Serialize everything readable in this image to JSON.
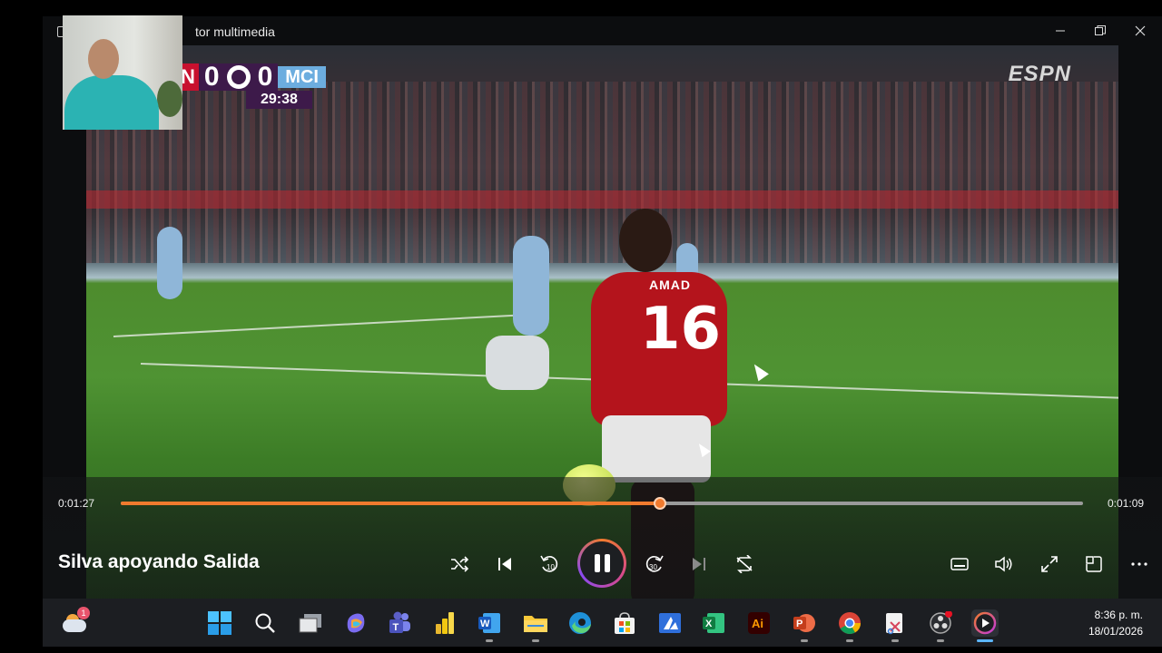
{
  "window": {
    "title": "tor multimedia",
    "minimize_icon": "minimize-icon",
    "restore_icon": "restore-icon",
    "close_icon": "close-icon"
  },
  "video": {
    "scoreboard": {
      "home_team": "N",
      "home_score": "0",
      "away_score": "0",
      "away_team": "MCI",
      "match_clock": "29:38"
    },
    "broadcaster": "ESPN",
    "jersey_name": "AMAD",
    "jersey_number": "16"
  },
  "player": {
    "elapsed": "0:01:27",
    "remaining": "0:01:09",
    "progress": 0.56,
    "title": "Silva apoyando Salida",
    "accent_color": "#f07a2e",
    "buttons": {
      "shuffle": "shuffle-icon",
      "previous": "previous-icon",
      "rewind": "10",
      "play_pause": "pause-icon",
      "forward": "30",
      "next": "next-icon",
      "repeat": "repeat-icon",
      "subtitles": "subtitles-icon",
      "volume": "volume-icon",
      "fullscreen": "fullscreen-icon",
      "miniplayer": "miniplayer-icon",
      "more": "more-icon"
    }
  },
  "taskbar": {
    "widget_badge": "1",
    "apps": [
      {
        "name": "start",
        "icon": "windows-start-icon"
      },
      {
        "name": "search",
        "icon": "search-icon"
      },
      {
        "name": "task-view",
        "icon": "task-view-icon"
      },
      {
        "name": "copilot",
        "icon": "copilot-icon"
      },
      {
        "name": "teams",
        "icon": "teams-icon"
      },
      {
        "name": "power-bi",
        "icon": "power-bi-icon"
      },
      {
        "name": "word",
        "icon": "word-icon"
      },
      {
        "name": "file-explorer",
        "icon": "folder-icon"
      },
      {
        "name": "edge",
        "icon": "edge-icon"
      },
      {
        "name": "store",
        "icon": "store-icon"
      },
      {
        "name": "azure",
        "icon": "azure-icon"
      },
      {
        "name": "excel",
        "icon": "excel-icon"
      },
      {
        "name": "illustrator",
        "icon": "illustrator-icon"
      },
      {
        "name": "powerpoint",
        "icon": "powerpoint-icon"
      },
      {
        "name": "chrome",
        "icon": "chrome-icon"
      },
      {
        "name": "snipping-tool",
        "icon": "snipping-tool-icon"
      },
      {
        "name": "obs",
        "icon": "obs-icon"
      },
      {
        "name": "media-player",
        "icon": "media-player-icon"
      }
    ],
    "illustrator_label": "Ai",
    "time": "8:36 p. m.",
    "date": "18/01/2026"
  }
}
